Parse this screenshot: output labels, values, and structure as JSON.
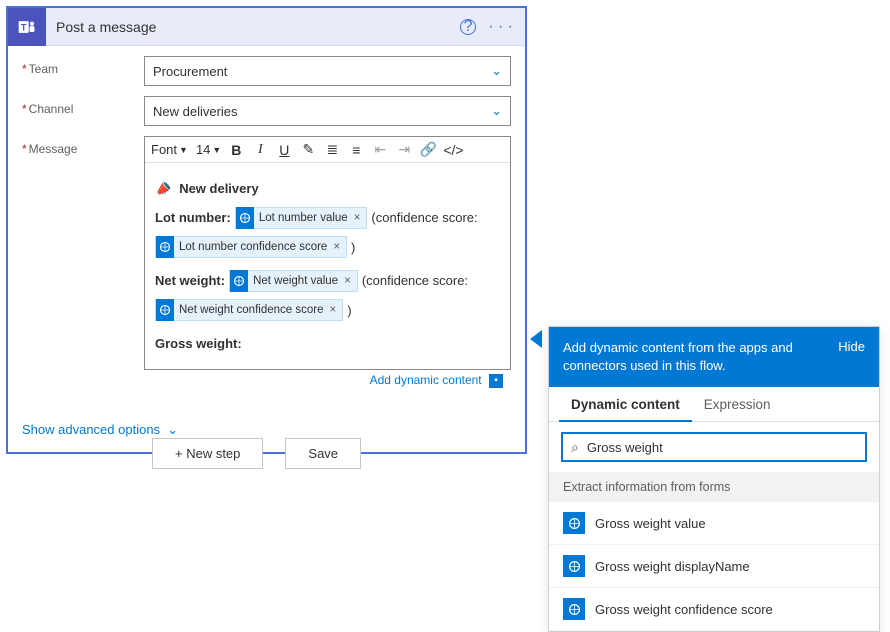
{
  "card": {
    "title": "Post a message",
    "fields": {
      "team_label": "Team",
      "team_value": "Procurement",
      "channel_label": "Channel",
      "channel_value": "New deliveries",
      "message_label": "Message"
    },
    "add_dynamic_content": "Add dynamic content",
    "show_advanced": "Show advanced options"
  },
  "toolbar": {
    "font": "Font",
    "size": "14"
  },
  "editor": {
    "heading": "New delivery",
    "lot_label": "Lot number:",
    "net_label": "Net weight:",
    "gross_label": "Gross weight:",
    "conf_open": "(confidence score:",
    "conf_close": ")",
    "token_lot_value": "Lot number value",
    "token_lot_conf": "Lot number confidence score",
    "token_net_value": "Net weight value",
    "token_net_conf": "Net weight confidence score"
  },
  "buttons": {
    "new_step": "+ New step",
    "save": "Save"
  },
  "popup": {
    "head_text": "Add dynamic content from the apps and connectors used in this flow.",
    "hide": "Hide",
    "tab_dynamic": "Dynamic content",
    "tab_expression": "Expression",
    "search_value": "Gross weight",
    "group": "Extract information from forms",
    "items": {
      "0": "Gross weight value",
      "1": "Gross weight displayName",
      "2": "Gross weight confidence score"
    }
  }
}
